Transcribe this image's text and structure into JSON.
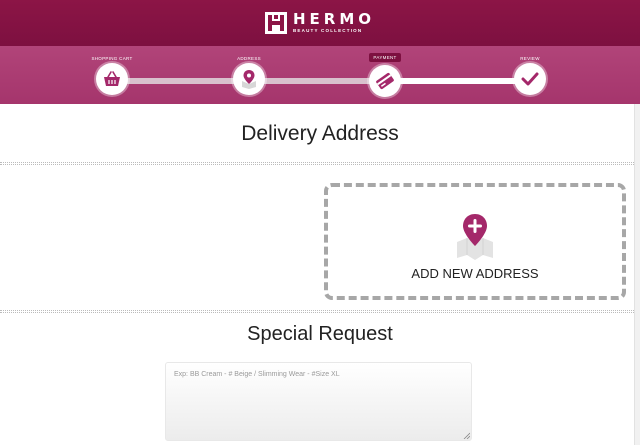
{
  "header": {
    "brand": "HERMO",
    "tagline": "BEAUTY COLLECTION",
    "colors": {
      "bar": "#8c1546",
      "steps": "#b14479",
      "accent": "#a4286a"
    }
  },
  "steps": [
    {
      "label": "SHOPPING CART",
      "icon": "basket-icon",
      "state": "done"
    },
    {
      "label": "ADDRESS",
      "icon": "map-pin-icon",
      "state": "done"
    },
    {
      "label": "PAYMENT",
      "icon": "credit-card-icon",
      "state": "active"
    },
    {
      "label": "REVIEW",
      "icon": "checkmark-icon",
      "state": "pending"
    }
  ],
  "delivery": {
    "title": "Delivery Address",
    "add_label": "ADD NEW ADDRESS",
    "add_icon": "add-location-icon"
  },
  "special_request": {
    "title": "Special Request",
    "placeholder": "Exp: BB Cream - # Beige / Slimming Wear - #Size XL",
    "value": ""
  }
}
